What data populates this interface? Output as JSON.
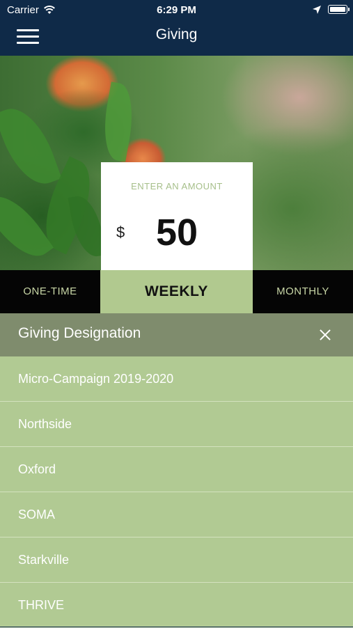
{
  "status": {
    "carrier": "Carrier",
    "time": "6:29 PM"
  },
  "nav": {
    "title": "Giving",
    "menu_icon": "hamburger-icon"
  },
  "amount": {
    "label": "ENTER AN AMOUNT",
    "currency": "$",
    "value": "50"
  },
  "frequency": {
    "options": [
      "ONE-TIME",
      "WEEKLY",
      "MONTHLY"
    ],
    "selected": "WEEKLY"
  },
  "designation": {
    "title": "Giving Designation",
    "items": [
      "Micro-Campaign 2019-2020",
      "Northside",
      "Oxford",
      "SOMA",
      "Starkville",
      "THRIVE"
    ]
  },
  "colors": {
    "nav": "#0f2a48",
    "accent": "#b1c98f",
    "sheet_header": "#7f8c6d",
    "tab_off": "#050505"
  }
}
